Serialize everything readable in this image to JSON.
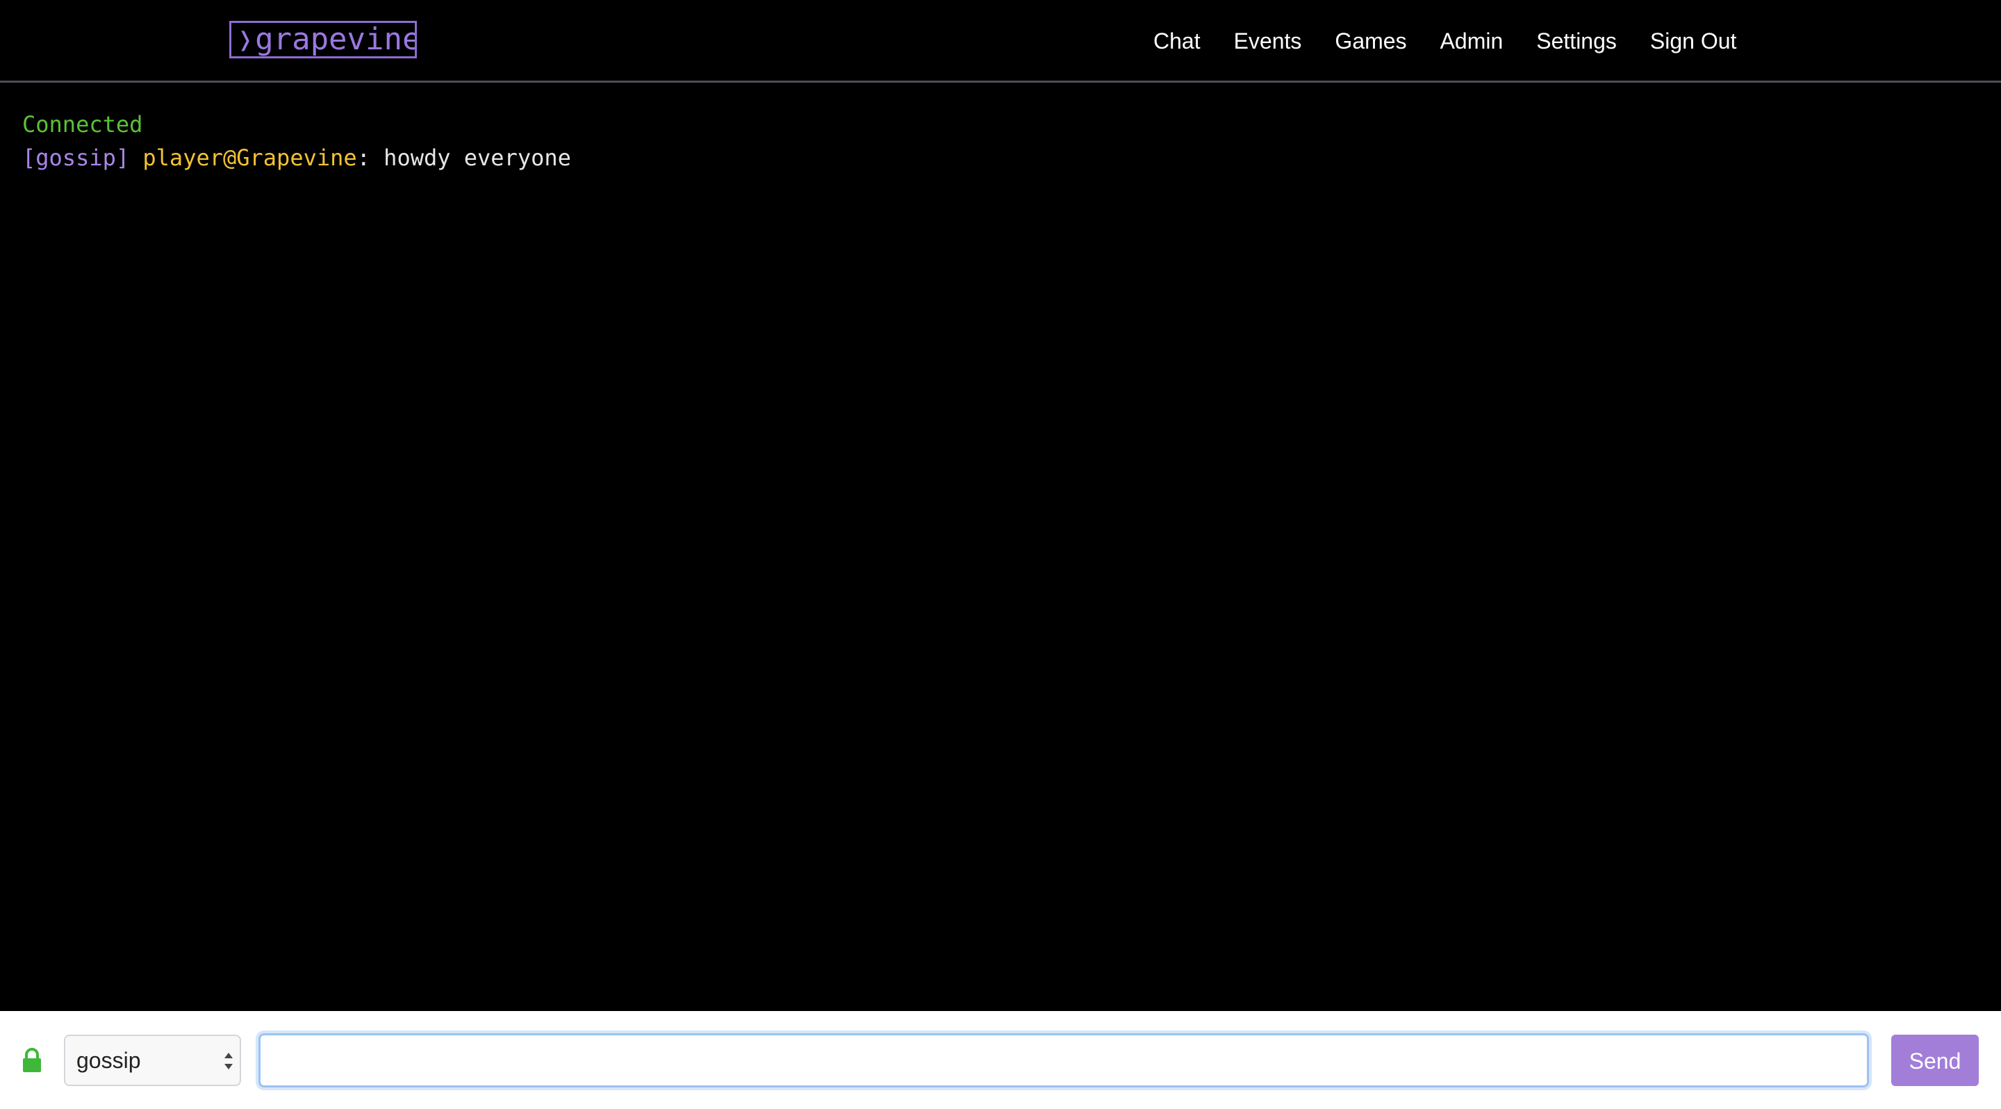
{
  "header": {
    "logo_text": "grapevine",
    "nav": [
      {
        "label": "Chat"
      },
      {
        "label": "Events"
      },
      {
        "label": "Games"
      },
      {
        "label": "Admin"
      },
      {
        "label": "Settings"
      },
      {
        "label": "Sign Out"
      }
    ]
  },
  "terminal": {
    "status": "Connected",
    "messages": [
      {
        "channel": "[gossip]",
        "sender": "player@Grapevine",
        "separator": ": ",
        "text": "howdy everyone"
      }
    ]
  },
  "composer": {
    "lock_icon": "lock-icon",
    "channel_selected": "gossip",
    "input_value": "",
    "send_label": "Send"
  },
  "colors": {
    "brand": "#9a78e0",
    "connected": "#5bc236",
    "channel": "#a986e6",
    "sender": "#f2c233",
    "send_button": "#a27ed9",
    "lock": "#3fb83a"
  }
}
